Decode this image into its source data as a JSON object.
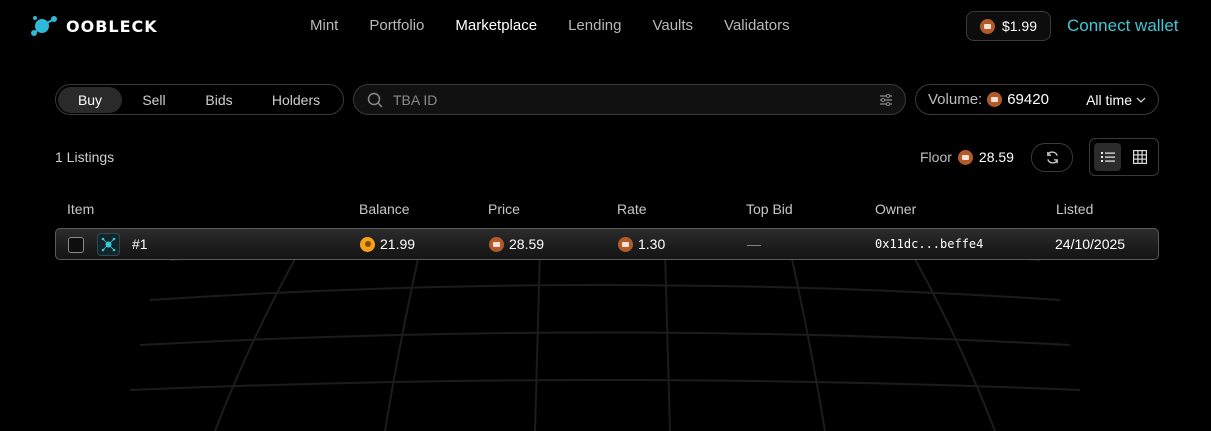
{
  "header": {
    "logo_text": "OOBLECK",
    "nav": [
      "Mint",
      "Portfolio",
      "Marketplace",
      "Lending",
      "Vaults",
      "Validators"
    ],
    "active_nav": "Marketplace",
    "token_price": "$1.99",
    "connect_label": "Connect wallet"
  },
  "toolbar": {
    "tabs": [
      "Buy",
      "Sell",
      "Bids",
      "Holders"
    ],
    "active_tab": "Buy",
    "search_placeholder": "TBA ID",
    "volume_label": "Volume:",
    "volume_value": "69420",
    "period": "All time"
  },
  "summary": {
    "listings": "1 Listings",
    "floor_label": "Floor",
    "floor_value": "28.59"
  },
  "table": {
    "columns": [
      "Item",
      "Balance",
      "Price",
      "Rate",
      "Top Bid",
      "Owner",
      "Listed"
    ],
    "rows": [
      {
        "item": "#1",
        "balance": "21.99",
        "price": "28.59",
        "rate": "1.30",
        "top_bid": "—",
        "owner": "0x11dc...beffe4",
        "listed": "24/10/2025"
      }
    ]
  },
  "colors": {
    "accent": "#3ec7d6",
    "background": "#000000",
    "coin": "#b35a2b",
    "balance_coin": "#f4a21a"
  },
  "icons": [
    "logo-icon",
    "coin-icon",
    "search-icon",
    "filter-icon",
    "chevron-down-icon",
    "refresh-icon",
    "list-view-icon",
    "grid-view-icon"
  ]
}
